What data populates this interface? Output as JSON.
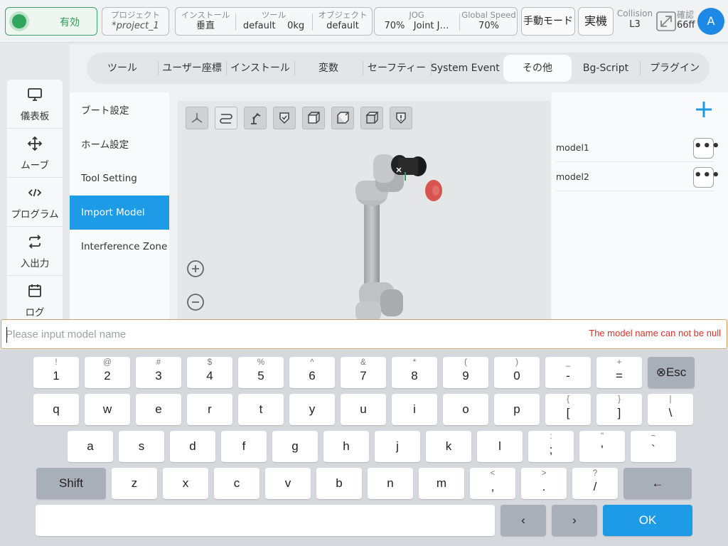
{
  "topbar": {
    "enable_label": "有効",
    "project": {
      "label": "プロジェクト",
      "value": "*project_1"
    },
    "install": {
      "label": "インストール",
      "value": "垂直"
    },
    "tool": {
      "label": "ツール",
      "value_name": "default",
      "value_weight": "0kg"
    },
    "object": {
      "label": "オブジェクト",
      "value": "default"
    },
    "jog": {
      "label": "JOG",
      "value_speed": "70%",
      "value_mode": "Joint J…"
    },
    "global_speed": {
      "label": "Global Speed",
      "value": "70%"
    },
    "manual_mode_label": "手動モード",
    "real_label": "実機",
    "collision": {
      "label": "Collision",
      "value": "L3"
    },
    "confirm": {
      "label": "確認",
      "value": "66ff"
    },
    "avatar": "A"
  },
  "leftnav": {
    "items": [
      {
        "label": "儀表板",
        "icon": "monitor-icon"
      },
      {
        "label": "ムーブ",
        "icon": "move-arrows-icon"
      },
      {
        "label": "プログラム",
        "icon": "code-icon"
      },
      {
        "label": "入出力",
        "icon": "swap-arrows-icon"
      },
      {
        "label": "ログ",
        "icon": "calendar-icon"
      }
    ]
  },
  "tabs": [
    {
      "label": "ツール"
    },
    {
      "label": "ユーザー座標"
    },
    {
      "label": "インストール"
    },
    {
      "label": "変数"
    },
    {
      "label": "セーフティー"
    },
    {
      "label": "System Event"
    },
    {
      "label": "その他",
      "active": true
    },
    {
      "label": "Bg-Script"
    },
    {
      "label": "プラグイン"
    }
  ],
  "submenu": [
    {
      "label": "ブート設定"
    },
    {
      "label": "ホーム設定"
    },
    {
      "label": "Tool Setting"
    },
    {
      "label": "Import Model",
      "active": true
    },
    {
      "label": "Interference Zone"
    }
  ],
  "models": [
    {
      "name": "model1"
    },
    {
      "name": "model2"
    }
  ],
  "input": {
    "value": "",
    "placeholder": "Please input model name",
    "error": "The model name can not be null"
  },
  "keyboard": {
    "row1": [
      {
        "sh": "!",
        "mn": "1"
      },
      {
        "sh": "@",
        "mn": "2"
      },
      {
        "sh": "#",
        "mn": "3"
      },
      {
        "sh": "$",
        "mn": "4"
      },
      {
        "sh": "%",
        "mn": "5"
      },
      {
        "sh": "^",
        "mn": "6"
      },
      {
        "sh": "&",
        "mn": "7"
      },
      {
        "sh": "*",
        "mn": "8"
      },
      {
        "sh": "(",
        "mn": "9"
      },
      {
        "sh": ")",
        "mn": "0"
      },
      {
        "sh": "_",
        "mn": "-"
      },
      {
        "sh": "+",
        "mn": "="
      }
    ],
    "esc": "⊗Esc",
    "row2": [
      {
        "sh": "",
        "mn": "q"
      },
      {
        "sh": "",
        "mn": "w"
      },
      {
        "sh": "",
        "mn": "e"
      },
      {
        "sh": "",
        "mn": "r"
      },
      {
        "sh": "",
        "mn": "t"
      },
      {
        "sh": "",
        "mn": "y"
      },
      {
        "sh": "",
        "mn": "u"
      },
      {
        "sh": "",
        "mn": "i"
      },
      {
        "sh": "",
        "mn": "o"
      },
      {
        "sh": "",
        "mn": "p"
      },
      {
        "sh": "{",
        "mn": "["
      },
      {
        "sh": "}",
        "mn": "]"
      },
      {
        "sh": "|",
        "mn": "\\"
      }
    ],
    "row3": [
      {
        "sh": "",
        "mn": "a"
      },
      {
        "sh": "",
        "mn": "s"
      },
      {
        "sh": "",
        "mn": "d"
      },
      {
        "sh": "",
        "mn": "f"
      },
      {
        "sh": "",
        "mn": "g"
      },
      {
        "sh": "",
        "mn": "h"
      },
      {
        "sh": "",
        "mn": "j"
      },
      {
        "sh": "",
        "mn": "k"
      },
      {
        "sh": "",
        "mn": "l"
      },
      {
        "sh": ":",
        "mn": ";"
      },
      {
        "sh": "\"",
        "mn": "'"
      },
      {
        "sh": "~",
        "mn": "`"
      }
    ],
    "shift": "Shift",
    "row4": [
      {
        "sh": "",
        "mn": "z"
      },
      {
        "sh": "",
        "mn": "x"
      },
      {
        "sh": "",
        "mn": "c"
      },
      {
        "sh": "",
        "mn": "v"
      },
      {
        "sh": "",
        "mn": "b"
      },
      {
        "sh": "",
        "mn": "n"
      },
      {
        "sh": "",
        "mn": "m"
      },
      {
        "sh": "<",
        "mn": ","
      },
      {
        "sh": ">",
        "mn": "."
      },
      {
        "sh": "?",
        "mn": "/"
      }
    ],
    "backspace": "←",
    "prev": "‹",
    "next": "›",
    "ok": "OK"
  },
  "colors": {
    "accent": "#1e9be6",
    "enable": "#2fa55e",
    "error": "#d9322b"
  }
}
